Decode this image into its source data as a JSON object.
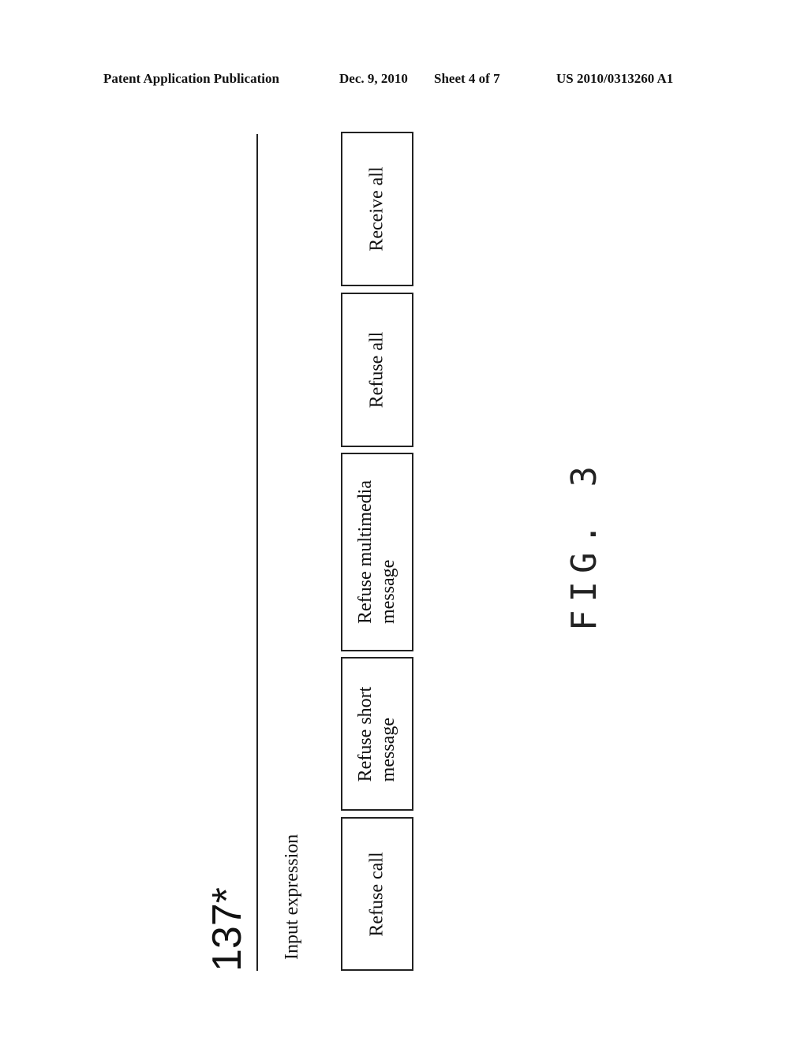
{
  "header": {
    "publication": "Patent Application Publication",
    "date": "Dec. 9, 2010",
    "sheet": "Sheet 4 of 7",
    "number": "US 2010/0313260 A1"
  },
  "figure": {
    "reference_label": "137*",
    "input_label": "Input expression",
    "buttons": [
      {
        "label": "Receive all"
      },
      {
        "label": "Refuse all"
      },
      {
        "label": "Refuse multimedia\nmessage"
      },
      {
        "label": "Refuse short\nmessage"
      },
      {
        "label": "Refuse call"
      }
    ],
    "caption": "FIG. 3"
  }
}
